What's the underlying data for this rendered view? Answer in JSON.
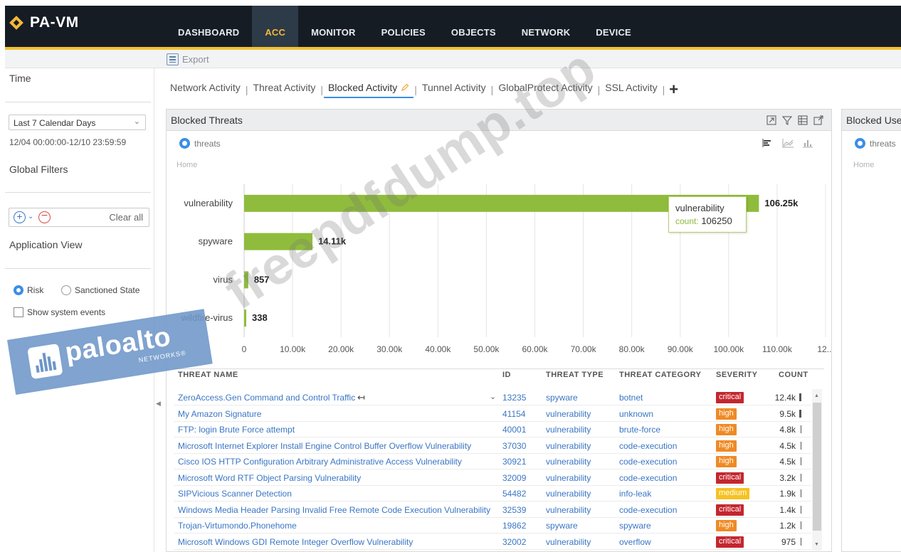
{
  "app": {
    "title": "PA-VM"
  },
  "nav": [
    "DASHBOARD",
    "ACC",
    "MONITOR",
    "POLICIES",
    "OBJECTS",
    "NETWORK",
    "DEVICE"
  ],
  "export_label": "Export",
  "left_panel": {
    "time_heading": "Time",
    "time_select": "Last 7 Calendar Days",
    "time_range": "12/04 00:00:00-12/10 23:59:59",
    "global_filters_heading": "Global Filters",
    "clear_all": "Clear all",
    "application_view_heading": "Application View",
    "radio_risk": "Risk",
    "radio_sanctioned": "Sanctioned State",
    "show_system_events": "Show system events"
  },
  "subtabs": [
    "Network Activity",
    "Threat Activity",
    "Blocked Activity",
    "Tunnel Activity",
    "GlobalProtect Activity",
    "SSL Activity"
  ],
  "widget": {
    "title": "Blocked Threats",
    "legend": "threats",
    "home": "Home",
    "tooltip": {
      "name": "vulnerability",
      "count_label": "count:",
      "count_value": "106250"
    }
  },
  "right_widget": {
    "title": "Blocked Users",
    "legend": "threats",
    "home": "Home"
  },
  "chart_data": {
    "type": "bar",
    "orientation": "horizontal",
    "categories": [
      "vulnerability",
      "spyware",
      "virus",
      "wildfire-virus"
    ],
    "values": [
      106250,
      14110,
      857,
      338
    ],
    "value_labels": [
      "106.25k",
      "14.11k",
      "857",
      "338"
    ],
    "x_ticks": [
      "0",
      "10.00k",
      "20.00k",
      "30.00k",
      "40.00k",
      "50.00k",
      "60.00k",
      "70.00k",
      "80.00k",
      "90.00k",
      "100.00k",
      "110.00k",
      "12..."
    ],
    "xlim": [
      0,
      120000
    ],
    "bar_color": "#8fbc3c",
    "grid": true
  },
  "table": {
    "headers": [
      "THREAT NAME",
      "ID",
      "THREAT TYPE",
      "THREAT CATEGORY",
      "SEVERITY",
      "COUNT"
    ],
    "rows": [
      {
        "name": "ZeroAccess.Gen Command and Control Traffic",
        "id": "13235",
        "type": "spyware",
        "category": "botnet",
        "severity": "critical",
        "count": "12.4k",
        "bar": 0.85
      },
      {
        "name": "My Amazon Signature",
        "id": "41154",
        "type": "vulnerability",
        "category": "unknown",
        "severity": "high",
        "count": "9.5k",
        "bar": 0.65
      },
      {
        "name": "FTP: login Brute Force attempt",
        "id": "40001",
        "type": "vulnerability",
        "category": "brute-force",
        "severity": "high",
        "count": "4.8k",
        "bar": 0.35
      },
      {
        "name": "Microsoft Internet Explorer Install Engine Control Buffer Overflow Vulnerability",
        "id": "37030",
        "type": "vulnerability",
        "category": "code-execution",
        "severity": "high",
        "count": "4.5k",
        "bar": 0.32
      },
      {
        "name": "Cisco IOS HTTP Configuration Arbitrary Administrative Access Vulnerability",
        "id": "30921",
        "type": "vulnerability",
        "category": "code-execution",
        "severity": "high",
        "count": "4.5k",
        "bar": 0.32
      },
      {
        "name": "Microsoft Word RTF Object Parsing Vulnerability",
        "id": "32009",
        "type": "vulnerability",
        "category": "code-execution",
        "severity": "critical",
        "count": "3.2k",
        "bar": 0.25
      },
      {
        "name": "SIPVicious Scanner Detection",
        "id": "54482",
        "type": "vulnerability",
        "category": "info-leak",
        "severity": "medium",
        "count": "1.9k",
        "bar": 0.16
      },
      {
        "name": "Windows Media Header Parsing Invalid Free Remote Code Execution Vulnerability",
        "id": "32539",
        "type": "vulnerability",
        "category": "code-execution",
        "severity": "critical",
        "count": "1.4k",
        "bar": 0.12
      },
      {
        "name": "Trojan-Virtumondo.Phonehome",
        "id": "19862",
        "type": "spyware",
        "category": "spyware",
        "severity": "high",
        "count": "1.2k",
        "bar": 0.1
      },
      {
        "name": "Microsoft Windows GDI Remote Integer Overflow Vulnerability",
        "id": "32002",
        "type": "vulnerability",
        "category": "overflow",
        "severity": "critical",
        "count": "975",
        "bar": 0.08
      }
    ]
  },
  "overlays": {
    "watermark": "freepdfdump.top",
    "logo_text": "paloalto",
    "logo_sub": "NETWORKS®"
  }
}
